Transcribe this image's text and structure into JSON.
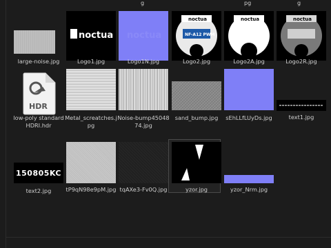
{
  "top_cut": {
    "col1": "g",
    "col2": "pg",
    "col3": "g"
  },
  "assets": {
    "r1": [
      {
        "name": "large-noise.jpg"
      },
      {
        "name": "Logo1.jpg"
      },
      {
        "name": "Logo1N.jpg"
      },
      {
        "name": "Logo2.jpg"
      },
      {
        "name": "Logo2A.jpg"
      },
      {
        "name": "Logo2R.jpg"
      }
    ],
    "r2": [
      {
        "name": "low-poly standard HDRI.hdr",
        "icon_text": "HDR"
      },
      {
        "name": "Metal_screatches.jpg"
      },
      {
        "name": "Noise-bump4504874.jpg"
      },
      {
        "name": "sand_bump.jpg"
      },
      {
        "name": "sEhLLfLUyDs.jpg"
      },
      {
        "name": "text1.jpg"
      }
    ],
    "r3": [
      {
        "name": "text2.jpg",
        "thumb_text": "150805KC"
      },
      {
        "name": "tP9qN98e9pM.jpg"
      },
      {
        "name": "tqAXe3-Fv0Q.jpg"
      },
      {
        "name": "yzor.jpg"
      },
      {
        "name": "yzor_Nrm.jpg"
      }
    ]
  },
  "logo": {
    "brand": "noctua",
    "model": "NF-A12 PWM"
  }
}
